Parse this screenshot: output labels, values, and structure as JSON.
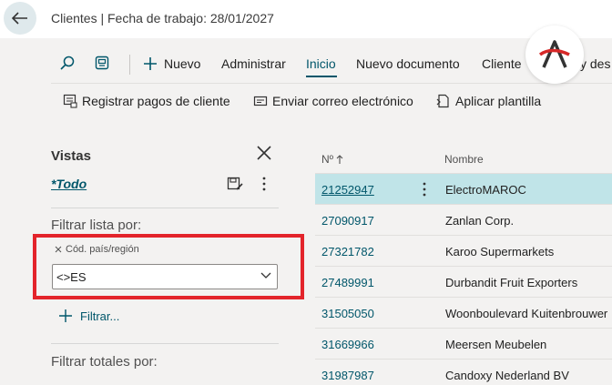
{
  "header": {
    "title": "Clientes | Fecha de trabajo: 28/01/2027"
  },
  "commandbar": {
    "row1": {
      "new_label": "Nuevo",
      "manage_label": "Administrar",
      "home_label": "Inicio",
      "new_document_label": "Nuevo documento",
      "customer_label": "Cliente",
      "extra_label": "y des"
    },
    "row2": {
      "register_payments_label": "Registrar pagos de cliente",
      "send_email_label": "Enviar correo electrónico",
      "apply_template_label": "Aplicar plantilla"
    }
  },
  "pane": {
    "title": "Vistas",
    "view_all": "*Todo",
    "filter_list_title": "Filtrar lista por:",
    "filter_field_label": "Cód. país/región",
    "filter_value": "<>ES",
    "add_filter_label": "Filtrar...",
    "filter_totals_title": "Filtrar totales por:"
  },
  "grid": {
    "columns": [
      "Nº",
      "Nombre"
    ],
    "rows": [
      {
        "no": "21252947",
        "name": "ElectroMAROC"
      },
      {
        "no": "27090917",
        "name": "Zanlan Corp."
      },
      {
        "no": "27321782",
        "name": "Karoo Supermarkets"
      },
      {
        "no": "27489991",
        "name": "Durbandit Fruit Exporters"
      },
      {
        "no": "31505050",
        "name": "Woonboulevard Kuitenbrouwer"
      },
      {
        "no": "31669966",
        "name": "Meersen Meubelen"
      },
      {
        "no": "31987987",
        "name": "Candoxy Nederland BV"
      }
    ]
  },
  "colors": {
    "accent": "#00566a",
    "highlight": "#e3242b",
    "selected_row": "#c0e4e8"
  },
  "icons": [
    "back-arrow-icon",
    "search-icon",
    "pin-icon",
    "plus-icon",
    "payments-icon",
    "email-icon",
    "template-icon",
    "close-icon",
    "save-view-icon",
    "more-icon",
    "chevron-down-icon",
    "sort-up-icon",
    "brand-logo"
  ]
}
